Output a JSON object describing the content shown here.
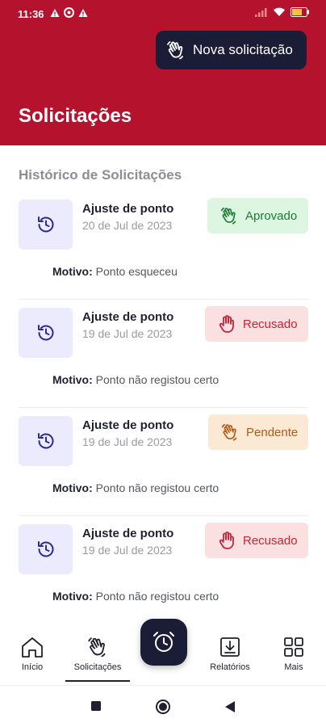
{
  "status_bar": {
    "time": "11:36"
  },
  "header": {
    "new_request_label": "Nova solicitação",
    "title": "Solicitações",
    "background": "#b5122e"
  },
  "section_title": "Histórico de Solicitações",
  "requests": [
    {
      "title": "Ajuste de ponto",
      "date": "20 de Jul de 2023",
      "status": "Aprovado",
      "status_type": "approved",
      "reason_label": "Motivo:",
      "reason": "Ponto esqueceu"
    },
    {
      "title": "Ajuste de ponto",
      "date": "19 de Jul de 2023",
      "status": "Recusado",
      "status_type": "refused",
      "reason_label": "Motivo:",
      "reason": "Ponto não registou certo"
    },
    {
      "title": "Ajuste de ponto",
      "date": "19 de Jul de 2023",
      "status": "Pendente",
      "status_type": "pending",
      "reason_label": "Motivo:",
      "reason": "Ponto não registou certo"
    },
    {
      "title": "Ajuste de ponto",
      "date": "19 de Jul de 2023",
      "status": "Recusado",
      "status_type": "refused",
      "reason_label": "Motivo:",
      "reason": "Ponto não registou certo"
    }
  ],
  "bottom_nav": {
    "items": [
      {
        "label": "Início",
        "icon": "home-icon"
      },
      {
        "label": "Solicitações",
        "icon": "hand-wave-icon",
        "active": true
      },
      {
        "label": "Relatórios",
        "icon": "download-icon"
      },
      {
        "label": "Mais",
        "icon": "grid-icon"
      }
    ],
    "fab_icon": "alarm-clock-icon"
  },
  "colors": {
    "accent": "#b5122e",
    "dark": "#1b1c35",
    "approved": "#1c7a35",
    "refused": "#c72336",
    "pending": "#b35815"
  }
}
